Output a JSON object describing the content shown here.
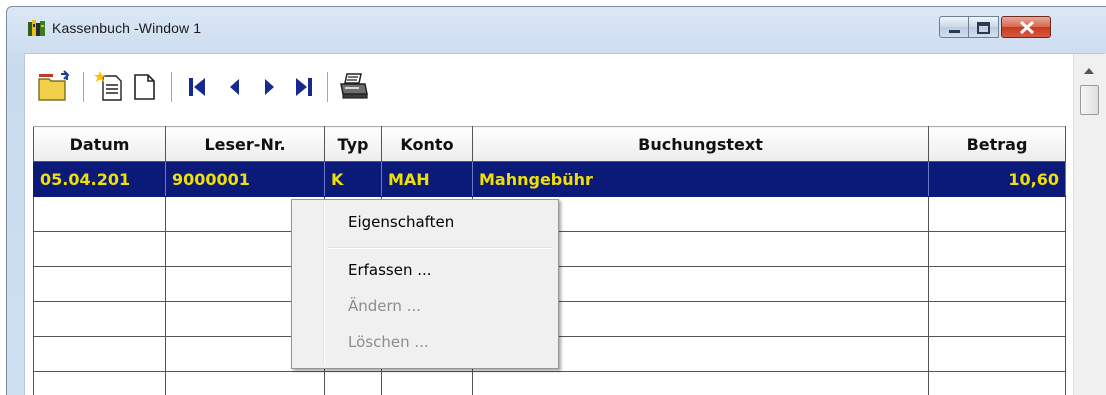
{
  "window": {
    "title": "Kassenbuch  -Window 1",
    "icon": "books-icon",
    "controls": [
      "minimize-icon",
      "maximize-icon",
      "close-icon"
    ]
  },
  "toolbar": {
    "buttons": [
      {
        "name": "open-folder-button",
        "icon": "folder-open-icon"
      },
      {
        "name": "new-entry-button",
        "icon": "new-document-star-icon"
      },
      {
        "name": "blank-document-button",
        "icon": "document-icon"
      },
      {
        "name": "first-record-button",
        "icon": "first-record-icon"
      },
      {
        "name": "previous-record-button",
        "icon": "previous-icon"
      },
      {
        "name": "next-record-button",
        "icon": "next-icon"
      },
      {
        "name": "last-record-button",
        "icon": "last-record-icon"
      },
      {
        "name": "print-button",
        "icon": "printer-icon"
      }
    ]
  },
  "table": {
    "columns": [
      "Datum",
      "Leser-Nr.",
      "Typ",
      "Konto",
      "Buchungstext",
      "Betrag"
    ],
    "rows": [
      [
        "05.04.201",
        "9000001",
        "K",
        "MAH",
        "Mahngebühr",
        "10,60"
      ]
    ],
    "selected_row_bg": "#0b1a78",
    "selected_row_fg": "#f0e000"
  },
  "context_menu": {
    "items": [
      {
        "label": "Eigenschaften",
        "enabled": true
      },
      {
        "label": "Erfassen ...",
        "enabled": true
      },
      {
        "label": "Ändern ...",
        "enabled": false
      },
      {
        "label": "Löschen ...",
        "enabled": false
      }
    ]
  }
}
